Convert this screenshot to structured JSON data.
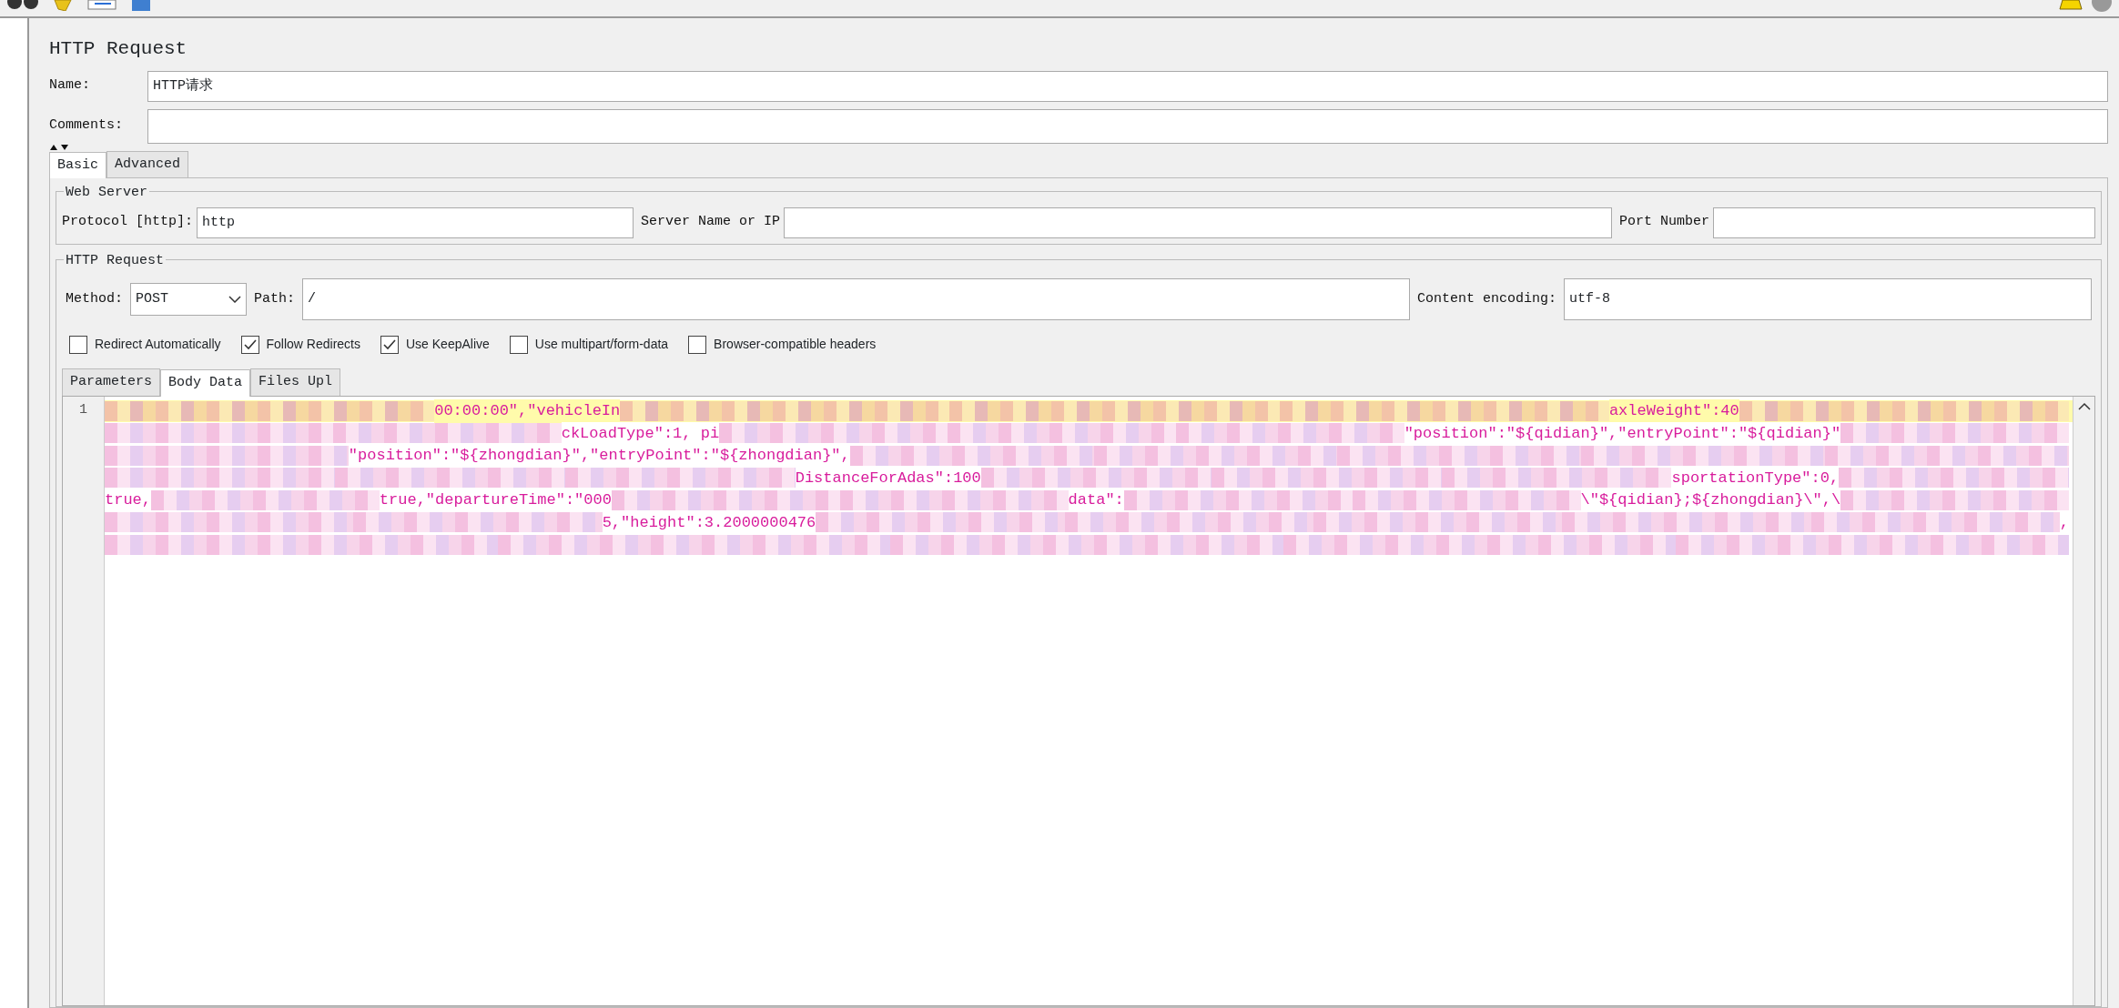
{
  "title": "HTTP Request",
  "name": {
    "label": "Name:",
    "value": "HTTP请求"
  },
  "comments": {
    "label": "Comments:"
  },
  "tabs": [
    {
      "label": "Basic",
      "selected": true
    },
    {
      "label": "Advanced",
      "selected": false
    }
  ],
  "web_server": {
    "legend": "Web Server",
    "protocol": {
      "label": "Protocol [http]:",
      "value": "http"
    },
    "server": {
      "label": "Server Name or IP"
    },
    "port": {
      "label": "Port Number"
    }
  },
  "http_request": {
    "legend": "HTTP Request",
    "method": {
      "label": "Method:",
      "value": "POST"
    },
    "path": {
      "label": "Path:",
      "value": "/"
    },
    "encoding": {
      "label": "Content encoding:",
      "value": "utf-8"
    },
    "options": [
      {
        "label": "Redirect Automatically",
        "checked": false
      },
      {
        "label": "Follow Redirects",
        "checked": true
      },
      {
        "label": "Use KeepAlive",
        "checked": true
      },
      {
        "label": "Use multipart/form-data",
        "checked": false
      },
      {
        "label": "Browser-compatible headers",
        "checked": false
      }
    ]
  },
  "body_tabs": [
    {
      "label": "Parameters",
      "selected": false
    },
    {
      "label": "Body Data",
      "selected": true
    },
    {
      "label": "Files Upl",
      "selected": false
    }
  ],
  "editor": {
    "line_number": "1",
    "lines": [
      {
        "current": true,
        "segments": [
          {
            "kind": "redacted"
          },
          {
            "kind": "text",
            "text": "00:00:00\",\"vehicleIn"
          },
          {
            "kind": "redacted"
          },
          {
            "kind": "redacted"
          },
          {
            "kind": "redacted"
          },
          {
            "kind": "text",
            "text": "axleWeight\":40"
          },
          {
            "kind": "redacted"
          }
        ]
      },
      {
        "current": false,
        "segments": [
          {
            "kind": "redacted"
          },
          {
            "kind": "redacted"
          },
          {
            "kind": "text",
            "text": "ckLoadType\":1, pi"
          },
          {
            "kind": "redacted"
          },
          {
            "kind": "redacted"
          },
          {
            "kind": "redacted"
          },
          {
            "kind": "text",
            "text": "\"position\":\"${qidian}\",\"entryPoint\":\"${qidian}\""
          },
          {
            "kind": "redacted"
          }
        ]
      },
      {
        "current": false,
        "segments": [
          {
            "kind": "redacted"
          },
          {
            "kind": "text",
            "text": "\"position\":\"${zhongdian}\",\"entryPoint\":\"${zhongdian}\","
          },
          {
            "kind": "redacted"
          },
          {
            "kind": "redacted"
          },
          {
            "kind": "redacted"
          },
          {
            "kind": "redacted"
          },
          {
            "kind": "redacted"
          }
        ]
      },
      {
        "current": false,
        "segments": [
          {
            "kind": "redacted"
          },
          {
            "kind": "redacted"
          },
          {
            "kind": "redacted"
          },
          {
            "kind": "text",
            "text": "DistanceForAdas\":100"
          },
          {
            "kind": "redacted"
          },
          {
            "kind": "redacted"
          },
          {
            "kind": "redacted"
          },
          {
            "kind": "text",
            "text": "sportationType\":0,"
          },
          {
            "kind": "redacted"
          }
        ]
      },
      {
        "current": false,
        "segments": [
          {
            "kind": "text",
            "text": "true,"
          },
          {
            "kind": "redacted"
          },
          {
            "kind": "text",
            "text": "true,\"departureTime\":\"000"
          },
          {
            "kind": "redacted"
          },
          {
            "kind": "redacted"
          },
          {
            "kind": "text",
            "text": "data\":"
          },
          {
            "kind": "redacted"
          },
          {
            "kind": "redacted"
          },
          {
            "kind": "text",
            "text": "\\\"${qidian};${zhongdian}\\\",\\"
          },
          {
            "kind": "redacted"
          }
        ]
      },
      {
        "current": false,
        "segments": [
          {
            "kind": "redacted"
          },
          {
            "kind": "redacted"
          },
          {
            "kind": "text",
            "text": "5,\"height\":3.2000000476"
          },
          {
            "kind": "redacted"
          },
          {
            "kind": "redacted"
          },
          {
            "kind": "redacted"
          },
          {
            "kind": "redacted"
          },
          {
            "kind": "redacted"
          },
          {
            "kind": "text",
            "text": ","
          }
        ]
      },
      {
        "current": false,
        "segments": [
          {
            "kind": "redacted"
          },
          {
            "kind": "redacted"
          },
          {
            "kind": "redacted"
          },
          {
            "kind": "redacted"
          },
          {
            "kind": "redacted"
          }
        ]
      }
    ]
  }
}
